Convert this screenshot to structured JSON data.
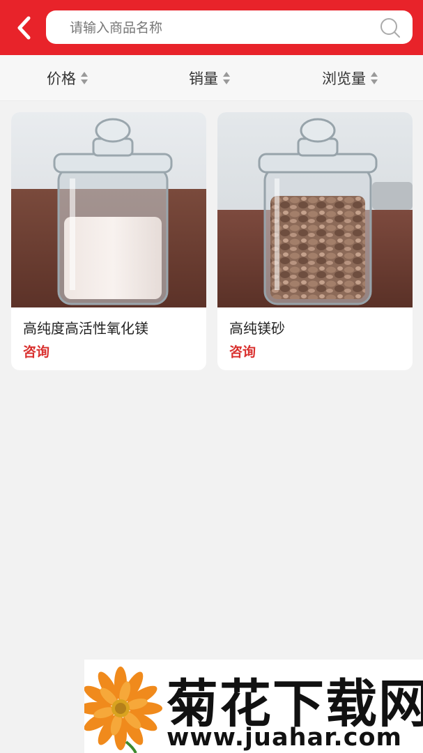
{
  "search": {
    "placeholder": "请输入商品名称",
    "value": ""
  },
  "sort": {
    "items": [
      {
        "label": "价格"
      },
      {
        "label": "销量"
      },
      {
        "label": "浏览量"
      }
    ]
  },
  "products": [
    {
      "title": "高纯度高活性氧化镁",
      "price": "咨询",
      "image": "glass jar with white powder"
    },
    {
      "title": "高纯镁砂",
      "price": "咨询",
      "image": "glass jar with brown granules"
    }
  ],
  "watermark": {
    "title": "菊花下载网",
    "url": "www.juahar.com"
  },
  "colors": {
    "header": "#e8232a",
    "price": "#d9302e",
    "background": "#f2f2f2"
  }
}
